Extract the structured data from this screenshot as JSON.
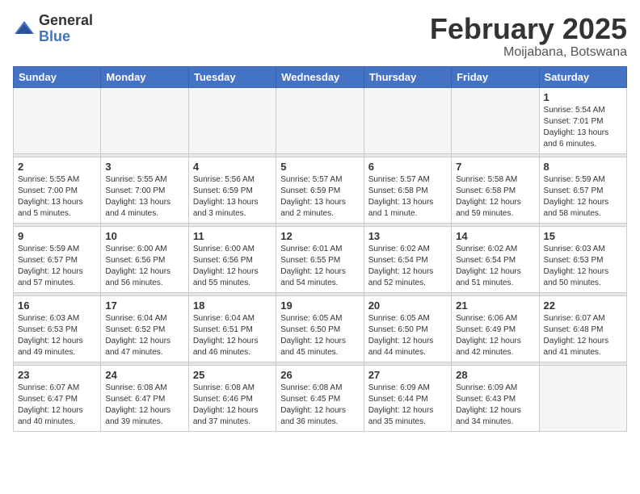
{
  "header": {
    "logo_general": "General",
    "logo_blue": "Blue",
    "month_title": "February 2025",
    "location": "Moijabana, Botswana"
  },
  "weekdays": [
    "Sunday",
    "Monday",
    "Tuesday",
    "Wednesday",
    "Thursday",
    "Friday",
    "Saturday"
  ],
  "weeks": [
    [
      {
        "day": "",
        "info": ""
      },
      {
        "day": "",
        "info": ""
      },
      {
        "day": "",
        "info": ""
      },
      {
        "day": "",
        "info": ""
      },
      {
        "day": "",
        "info": ""
      },
      {
        "day": "",
        "info": ""
      },
      {
        "day": "1",
        "info": "Sunrise: 5:54 AM\nSunset: 7:01 PM\nDaylight: 13 hours\nand 6 minutes."
      }
    ],
    [
      {
        "day": "2",
        "info": "Sunrise: 5:55 AM\nSunset: 7:00 PM\nDaylight: 13 hours\nand 5 minutes."
      },
      {
        "day": "3",
        "info": "Sunrise: 5:55 AM\nSunset: 7:00 PM\nDaylight: 13 hours\nand 4 minutes."
      },
      {
        "day": "4",
        "info": "Sunrise: 5:56 AM\nSunset: 6:59 PM\nDaylight: 13 hours\nand 3 minutes."
      },
      {
        "day": "5",
        "info": "Sunrise: 5:57 AM\nSunset: 6:59 PM\nDaylight: 13 hours\nand 2 minutes."
      },
      {
        "day": "6",
        "info": "Sunrise: 5:57 AM\nSunset: 6:58 PM\nDaylight: 13 hours\nand 1 minute."
      },
      {
        "day": "7",
        "info": "Sunrise: 5:58 AM\nSunset: 6:58 PM\nDaylight: 12 hours\nand 59 minutes."
      },
      {
        "day": "8",
        "info": "Sunrise: 5:59 AM\nSunset: 6:57 PM\nDaylight: 12 hours\nand 58 minutes."
      }
    ],
    [
      {
        "day": "9",
        "info": "Sunrise: 5:59 AM\nSunset: 6:57 PM\nDaylight: 12 hours\nand 57 minutes."
      },
      {
        "day": "10",
        "info": "Sunrise: 6:00 AM\nSunset: 6:56 PM\nDaylight: 12 hours\nand 56 minutes."
      },
      {
        "day": "11",
        "info": "Sunrise: 6:00 AM\nSunset: 6:56 PM\nDaylight: 12 hours\nand 55 minutes."
      },
      {
        "day": "12",
        "info": "Sunrise: 6:01 AM\nSunset: 6:55 PM\nDaylight: 12 hours\nand 54 minutes."
      },
      {
        "day": "13",
        "info": "Sunrise: 6:02 AM\nSunset: 6:54 PM\nDaylight: 12 hours\nand 52 minutes."
      },
      {
        "day": "14",
        "info": "Sunrise: 6:02 AM\nSunset: 6:54 PM\nDaylight: 12 hours\nand 51 minutes."
      },
      {
        "day": "15",
        "info": "Sunrise: 6:03 AM\nSunset: 6:53 PM\nDaylight: 12 hours\nand 50 minutes."
      }
    ],
    [
      {
        "day": "16",
        "info": "Sunrise: 6:03 AM\nSunset: 6:53 PM\nDaylight: 12 hours\nand 49 minutes."
      },
      {
        "day": "17",
        "info": "Sunrise: 6:04 AM\nSunset: 6:52 PM\nDaylight: 12 hours\nand 47 minutes."
      },
      {
        "day": "18",
        "info": "Sunrise: 6:04 AM\nSunset: 6:51 PM\nDaylight: 12 hours\nand 46 minutes."
      },
      {
        "day": "19",
        "info": "Sunrise: 6:05 AM\nSunset: 6:50 PM\nDaylight: 12 hours\nand 45 minutes."
      },
      {
        "day": "20",
        "info": "Sunrise: 6:05 AM\nSunset: 6:50 PM\nDaylight: 12 hours\nand 44 minutes."
      },
      {
        "day": "21",
        "info": "Sunrise: 6:06 AM\nSunset: 6:49 PM\nDaylight: 12 hours\nand 42 minutes."
      },
      {
        "day": "22",
        "info": "Sunrise: 6:07 AM\nSunset: 6:48 PM\nDaylight: 12 hours\nand 41 minutes."
      }
    ],
    [
      {
        "day": "23",
        "info": "Sunrise: 6:07 AM\nSunset: 6:47 PM\nDaylight: 12 hours\nand 40 minutes."
      },
      {
        "day": "24",
        "info": "Sunrise: 6:08 AM\nSunset: 6:47 PM\nDaylight: 12 hours\nand 39 minutes."
      },
      {
        "day": "25",
        "info": "Sunrise: 6:08 AM\nSunset: 6:46 PM\nDaylight: 12 hours\nand 37 minutes."
      },
      {
        "day": "26",
        "info": "Sunrise: 6:08 AM\nSunset: 6:45 PM\nDaylight: 12 hours\nand 36 minutes."
      },
      {
        "day": "27",
        "info": "Sunrise: 6:09 AM\nSunset: 6:44 PM\nDaylight: 12 hours\nand 35 minutes."
      },
      {
        "day": "28",
        "info": "Sunrise: 6:09 AM\nSunset: 6:43 PM\nDaylight: 12 hours\nand 34 minutes."
      },
      {
        "day": "",
        "info": ""
      }
    ]
  ]
}
